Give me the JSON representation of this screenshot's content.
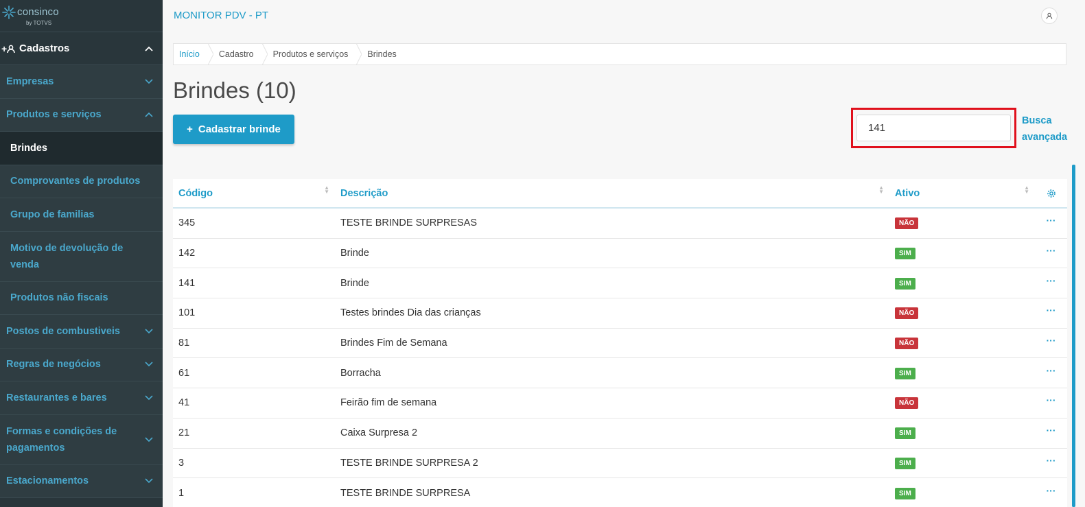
{
  "logo": {
    "brand": "consinco",
    "by": "by TOTVS"
  },
  "app_title": "MONITOR PDV - PT",
  "sidebar": {
    "section": "Cadastros",
    "items": [
      {
        "label": "Empresas",
        "type": "group",
        "expanded": false
      },
      {
        "label": "Produtos e serviços",
        "type": "group",
        "expanded": true
      },
      {
        "label": "Brindes",
        "type": "sub",
        "active": true
      },
      {
        "label": "Comprovantes de produtos",
        "type": "sub"
      },
      {
        "label": "Grupo de familias",
        "type": "sub"
      },
      {
        "label": "Motivo de devolução de venda",
        "type": "sub"
      },
      {
        "label": "Produtos não fiscais",
        "type": "sub"
      },
      {
        "label": "Postos de combustiveis",
        "type": "group",
        "expanded": false
      },
      {
        "label": "Regras de negócios",
        "type": "group",
        "expanded": false
      },
      {
        "label": "Restaurantes e bares",
        "type": "group",
        "expanded": false
      },
      {
        "label": "Formas e condições de pagamentos",
        "type": "group",
        "expanded": false
      },
      {
        "label": "Estacionamentos",
        "type": "group",
        "expanded": false
      }
    ]
  },
  "breadcrumb": [
    "Início",
    "Cadastro",
    "Produtos e serviços",
    "Brindes"
  ],
  "page": {
    "title": "Brindes (10)",
    "add_button": "Cadastrar brinde",
    "add_icon": "+",
    "search_value": "141",
    "advanced_search": "Busca avançada"
  },
  "table": {
    "columns": [
      "Código",
      "Descrição",
      "Ativo"
    ],
    "rows": [
      {
        "code": "345",
        "desc": "TESTE BRINDE SURPRESAS",
        "active": "NÃO"
      },
      {
        "code": "142",
        "desc": "Brinde",
        "active": "SIM"
      },
      {
        "code": "141",
        "desc": "Brinde",
        "active": "SIM"
      },
      {
        "code": "101",
        "desc": "Testes brindes Dia das crianças",
        "active": "NÃO"
      },
      {
        "code": "81",
        "desc": "Brindes Fim de Semana",
        "active": "NÃO"
      },
      {
        "code": "61",
        "desc": "Borracha",
        "active": "SIM"
      },
      {
        "code": "41",
        "desc": "Feirão fim de semana",
        "active": "NÃO"
      },
      {
        "code": "21",
        "desc": "Caixa Surpresa 2",
        "active": "SIM"
      },
      {
        "code": "3",
        "desc": "TESTE BRINDE SURPRESA 2",
        "active": "SIM"
      },
      {
        "code": "1",
        "desc": "TESTE BRINDE SURPRESA",
        "active": "SIM"
      }
    ],
    "row_action_label": "···"
  },
  "colors": {
    "accent": "#1e9bc8",
    "sidebar_bg": "#29363b",
    "no": "#c8343a",
    "yes": "#4cae4c",
    "highlight": "#e0101c"
  }
}
